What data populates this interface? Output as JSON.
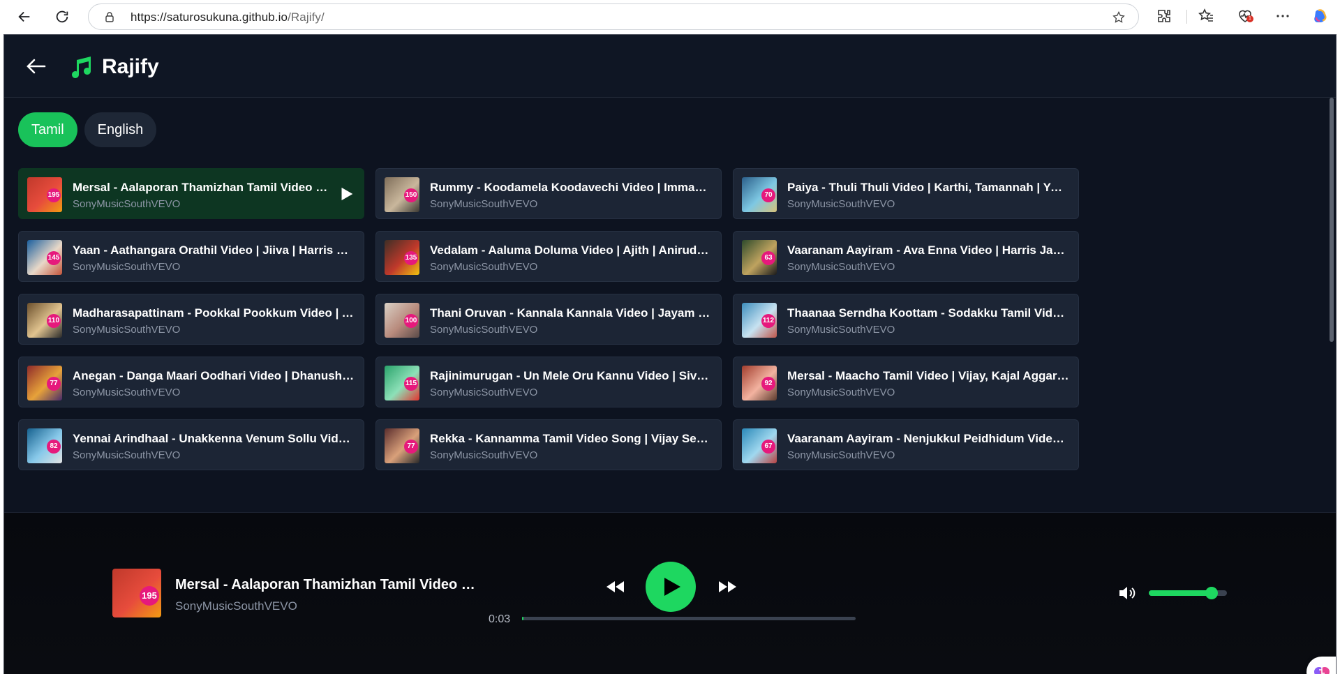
{
  "browser": {
    "url_host": "https://saturosukuna.github.io",
    "url_path": "/Rajify/",
    "notification_count": "1"
  },
  "app": {
    "name": "Rajify",
    "accent_color": "#1ed760"
  },
  "languages": [
    {
      "label": "Tamil",
      "active": true
    },
    {
      "label": "English",
      "active": false
    }
  ],
  "songs": [
    {
      "title": "Mersal - Aalaporan Thamizhan Tamil Video | Vijay, Kajal, Samantha, Nithya Menen",
      "artist": "SonyMusicSouthVEVO",
      "views_badge": "195",
      "playing": true
    },
    {
      "title": "Rummy - Koodamela Koodavechi Video | Imman | Vijay Sethupathi",
      "artist": "SonyMusicSouthVEVO",
      "views_badge": "150"
    },
    {
      "title": "Paiya - Thuli Thuli Video | Karthi, Tamannah | Yuvan Shankar Raja",
      "artist": "SonyMusicSouthVEVO",
      "views_badge": "70"
    },
    {
      "title": "Yaan - Aathangara Orathil Video | Jiiva | Harris Jayaraj",
      "artist": "SonyMusicSouthVEVO",
      "views_badge": "145"
    },
    {
      "title": "Vedalam - Aaluma Doluma Video | Ajith | Anirudh Ravichander",
      "artist": "SonyMusicSouthVEVO",
      "views_badge": "135"
    },
    {
      "title": "Vaaranam Aayiram - Ava Enna Video | Harris Jayaraj | Suriya",
      "artist": "SonyMusicSouthVEVO",
      "views_badge": "63"
    },
    {
      "title": "Madharasapattinam - Pookkal Pookkum Video | Aarya, Amy Jackson",
      "artist": "SonyMusicSouthVEVO",
      "views_badge": "110"
    },
    {
      "title": "Thani Oruvan - Kannala Kannala Video | Jayam Ravi, Nayanthara",
      "artist": "SonyMusicSouthVEVO",
      "views_badge": "100"
    },
    {
      "title": "Thaanaa Serndha Koottam - Sodakku Tamil Video | Suriya | Anirudh",
      "artist": "SonyMusicSouthVEVO",
      "views_badge": "112"
    },
    {
      "title": "Anegan - Danga Maari Oodhari Video | Dhanush | Harris Jayaraj",
      "artist": "SonyMusicSouthVEVO",
      "views_badge": "77"
    },
    {
      "title": "Rajinimurugan - Un Mele Oru Kannu Video | Sivakarthikeyan | Imman",
      "artist": "SonyMusicSouthVEVO",
      "views_badge": "115"
    },
    {
      "title": "Mersal - Maacho Tamil Video | Vijay, Kajal Aggarwal | A.R. Rahman",
      "artist": "SonyMusicSouthVEVO",
      "views_badge": "92"
    },
    {
      "title": "Yennai Arindhaal - Unakkenna Venum Sollu Video | Ajith Kumar",
      "artist": "SonyMusicSouthVEVO",
      "views_badge": "82"
    },
    {
      "title": "Rekka - Kannamma Tamil Video Song | Vijay Sethupathi | Imman",
      "artist": "SonyMusicSouthVEVO",
      "views_badge": "77"
    },
    {
      "title": "Vaaranam Aayiram - Nenjukkul Peidhidum Video | Harris Jayaraj",
      "artist": "SonyMusicSouthVEVO",
      "views_badge": "67"
    }
  ],
  "player": {
    "title": "Mersal - Aalaporan Thamizhan Tamil Video | Vijay, Kajal, Samantha, Nithya Menen",
    "artist": "SonyMusicSouthVEVO",
    "views_badge": "195",
    "current_time": "0:03",
    "progress_fraction": 0.005,
    "volume_fraction": 0.8
  }
}
